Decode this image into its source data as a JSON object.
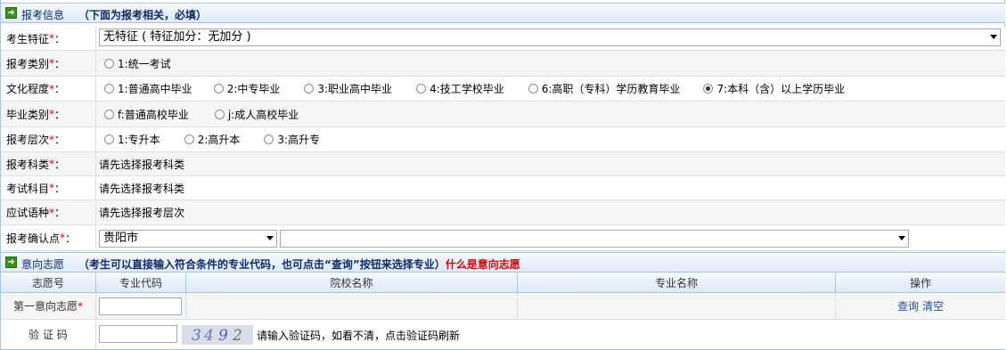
{
  "section1": {
    "title": "报考信息",
    "note": "（下面为报考相关，必填）"
  },
  "rows": {
    "feature": {
      "label": "考生特征",
      "colon": "：",
      "select": "无特征 ( 特征加分：无加分 )"
    },
    "category": {
      "label": "报考类别",
      "colon": "：",
      "options": [
        "1:统一考试"
      ]
    },
    "education": {
      "label": "文化程度",
      "colon": "：",
      "options": [
        "1:普通高中毕业",
        "2:中专毕业",
        "3:职业高中毕业",
        "4:技工学校毕业",
        "6:高职（专科）学历教育毕业",
        "7:本科（含）以上学历毕业"
      ],
      "selected": "7:本科（含）以上学历毕业"
    },
    "grad": {
      "label": "毕业类别",
      "colon": "：",
      "options": [
        "f:普通高校毕业",
        "j:成人高校毕业"
      ]
    },
    "level": {
      "label": "报考层次",
      "colon": "：",
      "options": [
        "1:专升本",
        "2:高升本",
        "3:高升专"
      ]
    },
    "subject_cat": {
      "label": "报考科类",
      "colon": "：",
      "value": "请先选择报考科类"
    },
    "exam_subject": {
      "label": "考试科目",
      "colon": "：",
      "value": "请先选择报考科类"
    },
    "language": {
      "label": "应试语种",
      "colon": "：",
      "value": "请先选择报考层次"
    },
    "confirm": {
      "label": "报考确认点",
      "colon": "：",
      "city": "贵阳市",
      "point": ""
    }
  },
  "section2": {
    "title": "意向志愿",
    "note": "（考生可以直接输入符合条件的专业代码，也可点击“查询”按钮来选择专业）",
    "link": "什么是意向志愿"
  },
  "table": {
    "headers": [
      "志愿号",
      "专业代码",
      "院校名称",
      "专业名称",
      "操作"
    ],
    "row1": {
      "label": "第一意向志愿",
      "query": "查询",
      "clear": "清空"
    },
    "captcha": {
      "label": "验 证 码",
      "digits": [
        "3",
        "4",
        "9",
        "2"
      ],
      "hint": "请输入验证码，如看不清，点击验证码刷新"
    }
  },
  "req_mark": "*",
  "colors": {
    "header_bg": "#dde9f7",
    "border": "#a9c4e0",
    "required": "#e00000",
    "link": "#1b4fa8",
    "icon": "#3c8f1e"
  }
}
